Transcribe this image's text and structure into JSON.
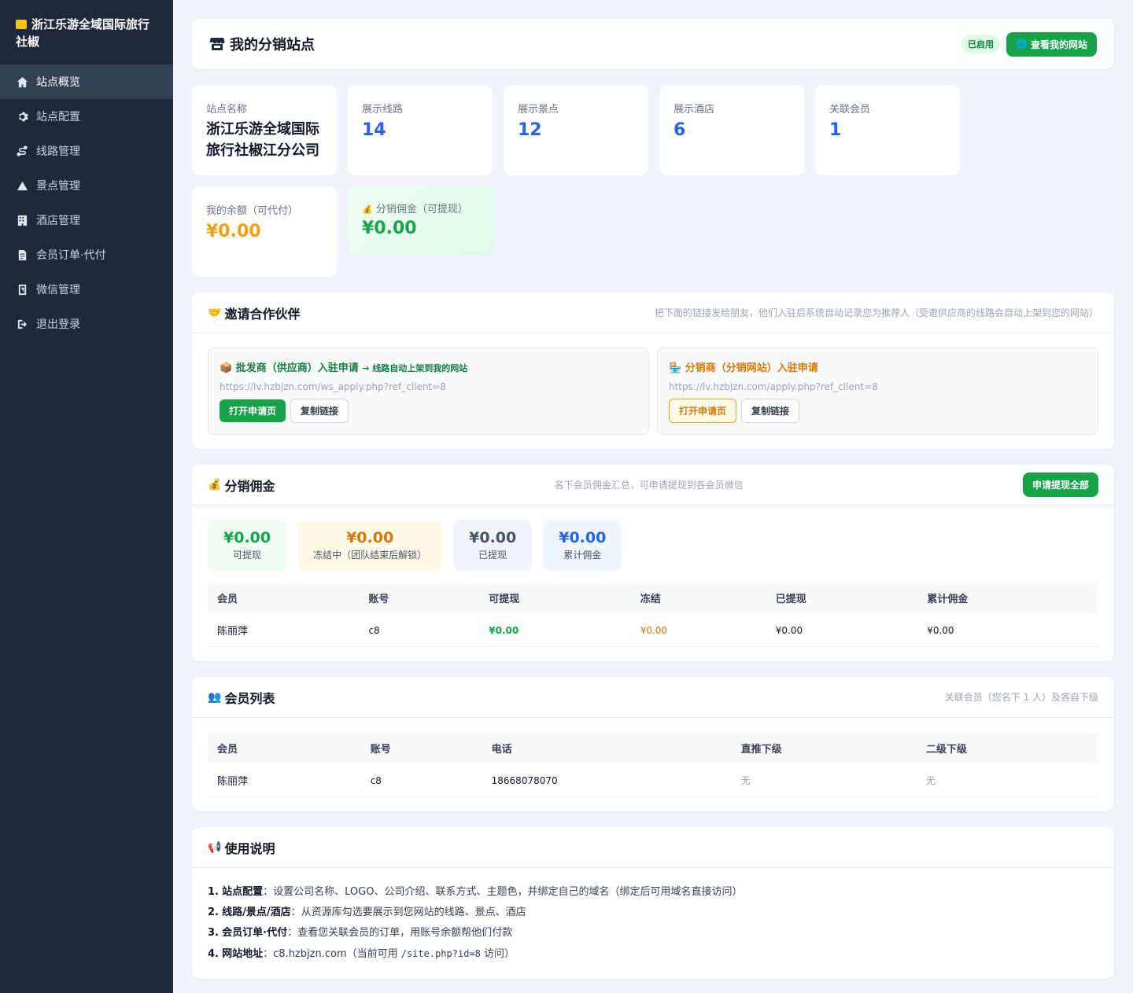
{
  "sidebar": {
    "brand": "浙江乐游全域国际旅行社椒",
    "items": [
      {
        "label": "站点概览",
        "icon": "home-icon"
      },
      {
        "label": "站点配置",
        "icon": "gear-icon"
      },
      {
        "label": "线路管理",
        "icon": "route-icon"
      },
      {
        "label": "景点管理",
        "icon": "mountain-icon"
      },
      {
        "label": "酒店管理",
        "icon": "building-icon"
      },
      {
        "label": "会员订单·代付",
        "icon": "document-icon"
      },
      {
        "label": "微信管理",
        "icon": "qrcode-icon"
      },
      {
        "label": "退出登录",
        "icon": "logout-icon"
      }
    ]
  },
  "header": {
    "title": "我的分销站点",
    "status_badge": "已启用",
    "view_site_button": "查看我的网站"
  },
  "stats": {
    "site_name": {
      "label": "站点名称",
      "value": "浙江乐游全域国际旅行社椒江分公司"
    },
    "routes": {
      "label": "展示线路",
      "value": "14"
    },
    "spots": {
      "label": "展示景点",
      "value": "12"
    },
    "hotels": {
      "label": "展示酒店",
      "value": "6"
    },
    "members": {
      "label": "关联会员",
      "value": "1"
    },
    "balance": {
      "label": "我的余额（可代付）",
      "value": "¥0.00"
    },
    "commission": {
      "label": "分销佣金（可提现）",
      "value": "¥0.00"
    }
  },
  "invite": {
    "title": "邀请合作伙伴",
    "hint": "把下面的链接发给朋友，他们入驻后系统自动记录您为推荐人（受邀供应商的线路会自动上架到您的网站）",
    "wholesale": {
      "title": "批发商（供应商）入驻申请",
      "note": "→ 线路自动上架到我的网站",
      "url": "https://lv.hzbjzn.com/ws_apply.php?ref_client=8",
      "open_label": "打开申请页",
      "copy_label": "复制链接"
    },
    "distributor": {
      "title": "分销商（分销网站）入驻申请",
      "url": "https://lv.hzbjzn.com/apply.php?ref_client=8",
      "open_label": "打开申请页",
      "copy_label": "复制链接"
    }
  },
  "commission": {
    "title": "分销佣金",
    "hint": "名下会员佣金汇总，可申请提现到各会员微信",
    "withdraw_all": "申请提现全部",
    "summary": [
      {
        "value": "¥0.00",
        "label": "可提现"
      },
      {
        "value": "¥0.00",
        "label": "冻结中（团队结束后解锁）"
      },
      {
        "value": "¥0.00",
        "label": "已提现"
      },
      {
        "value": "¥0.00",
        "label": "累计佣金"
      }
    ],
    "columns": [
      "会员",
      "账号",
      "可提现",
      "冻结",
      "已提现",
      "累计佣金"
    ],
    "rows": [
      [
        "陈丽萍",
        "c8",
        "¥0.00",
        "¥0.00",
        "¥0.00",
        "¥0.00"
      ]
    ]
  },
  "members": {
    "title": "会员列表",
    "hint": "关联会员（您名下 1 人）及各自下级",
    "columns": [
      "会员",
      "账号",
      "电话",
      "直推下级",
      "二级下级"
    ],
    "rows": [
      [
        "陈丽萍",
        "c8",
        "18668078070",
        "无",
        "无"
      ]
    ]
  },
  "notes": {
    "title": "使用说明",
    "items": [
      {
        "num": "1.",
        "key": "站点配置",
        "text": "：设置公司名称、LOGO、公司介绍、联系方式、主题色，并绑定自己的域名（绑定后可用域名直接访问）"
      },
      {
        "num": "2.",
        "key": "线路/景点/酒店",
        "text": "：从资源库勾选要展示到您网站的线路、景点、酒店"
      },
      {
        "num": "3.",
        "key": "会员订单·代付",
        "text": "：查看您关联会员的订单，用账号余额帮他们付款"
      },
      {
        "num": "4.",
        "key": "网站地址",
        "text_pre": "：c8.hzbjzn.com（当前可用 ",
        "code": "/site.php?id=8",
        "text_post": " 访问）"
      }
    ]
  }
}
